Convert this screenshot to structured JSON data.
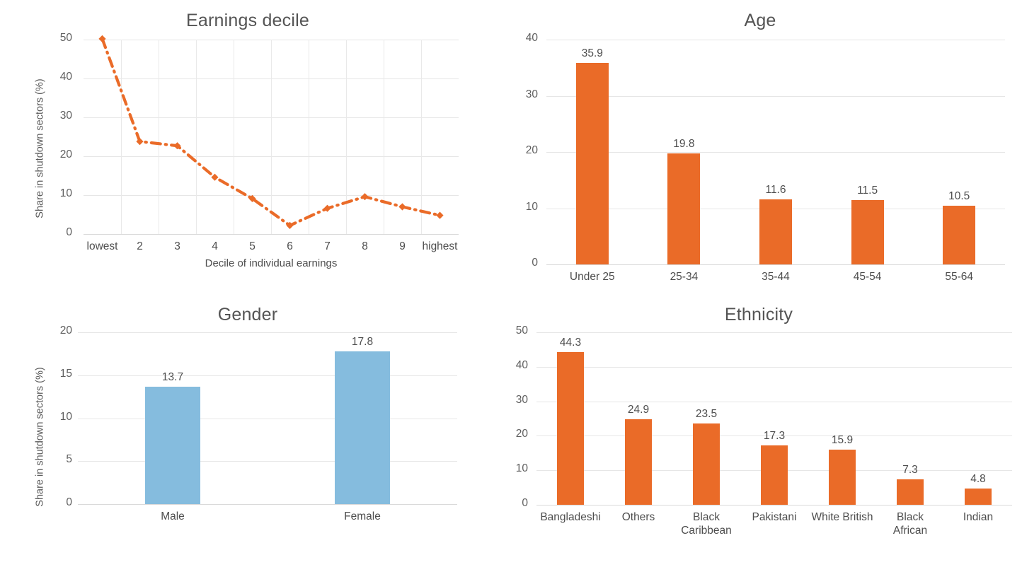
{
  "chart_data": [
    {
      "type": "line",
      "id": "earnings-decile",
      "title": "Earnings decile",
      "xlabel": "Decile of individual earnings",
      "ylabel": "Share in shutdown sectors (%)",
      "categories": [
        "lowest",
        "2",
        "3",
        "4",
        "5",
        "6",
        "7",
        "8",
        "9",
        "highest"
      ],
      "values": [
        50.2,
        23.8,
        22.7,
        14.6,
        9.1,
        2.2,
        6.6,
        9.6,
        7.0,
        4.8
      ],
      "yticks": [
        "0",
        "10",
        "20",
        "30",
        "40",
        "50"
      ],
      "ylim": [
        0,
        50
      ],
      "grid": true,
      "legend": "none",
      "series_color": "#ea6b28",
      "line_style": "dash-dot"
    },
    {
      "type": "bar",
      "id": "age",
      "title": "Age",
      "xlabel": "",
      "ylabel": "",
      "categories": [
        "Under 25",
        "25-34",
        "35-44",
        "45-54",
        "55-64"
      ],
      "values": [
        35.9,
        19.8,
        11.6,
        11.5,
        10.5
      ],
      "data_labels": [
        "35.9",
        "19.8",
        "11.6",
        "11.5",
        "10.5"
      ],
      "yticks": [
        "0",
        "10",
        "20",
        "30",
        "40"
      ],
      "ylim": [
        0,
        40
      ],
      "grid": true,
      "legend": "none",
      "series_color": "#ea6b28"
    },
    {
      "type": "bar",
      "id": "gender",
      "title": "Gender",
      "xlabel": "",
      "ylabel": "Share in shutdown sectors (%)",
      "categories": [
        "Male",
        "Female"
      ],
      "values": [
        13.7,
        17.8
      ],
      "data_labels": [
        "13.7",
        "17.8"
      ],
      "yticks": [
        "0",
        "5",
        "10",
        "15",
        "20"
      ],
      "ylim": [
        0,
        20
      ],
      "grid": true,
      "legend": "none",
      "series_color": "#85bcde"
    },
    {
      "type": "bar",
      "id": "ethnicity",
      "title": "Ethnicity",
      "xlabel": "",
      "ylabel": "",
      "categories": [
        "Bangladeshi",
        "Others",
        "Black\nCaribbean",
        "Pakistani",
        "White British",
        "Black\nAfrican",
        "Indian"
      ],
      "values": [
        44.3,
        24.9,
        23.5,
        17.3,
        15.9,
        7.3,
        4.8
      ],
      "data_labels": [
        "44.3",
        "24.9",
        "23.5",
        "17.3",
        "15.9",
        "7.3",
        "4.8"
      ],
      "yticks": [
        "0",
        "10",
        "20",
        "30",
        "40",
        "50"
      ],
      "ylim": [
        0,
        50
      ],
      "grid": true,
      "legend": "none",
      "series_color": "#ea6b28"
    }
  ],
  "colors": {
    "orange": "#ea6b28",
    "blue": "#85bcde",
    "grid": "#e6e6e6",
    "text": "#4d4d4d",
    "title": "#545454",
    "background": "#ffffff"
  }
}
